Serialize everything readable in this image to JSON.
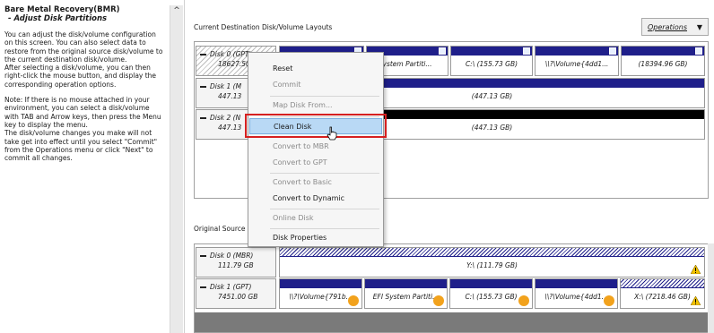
{
  "left_panel": {
    "title": "Bare Metal Recovery(BMR)",
    "subtitle": "- Adjust Disk Partitions",
    "para1": "You can adjust the disk/volume configuration\non this screen. You can also select data to\nrestore from the original source disk/volume to\nthe current destination disk/volume.\nAfter selecting a disk/volume, you can then\nright-click the mouse button, and display the\ncorresponding operation options.",
    "para2": "Note: If there is no mouse attached in your\nenvironment, you can select a disk/volume\nwith TAB and Arrow keys, then press the Menu\nkey to display the menu.\nThe disk/volume changes you make will not\ntake get into effect until you select \"Commit\"\nfrom the Operations menu or click \"Next\" to\ncommit all changes.",
    "scroll_up": "^"
  },
  "destination": {
    "title": "Current Destination Disk/Volume Layouts",
    "operations_label": "Operations",
    "disks": [
      {
        "name": "Disk 0 (GPT)",
        "size": "18627.50 GB",
        "partitions": [
          "ystem Partiti...",
          "C:\\ (155.73 GB)",
          "\\\\?\\Volume{4dd1...",
          "(18394.96 GB)"
        ]
      },
      {
        "name": "Disk 1 (M",
        "size": "447.13",
        "partitions": [
          "(447.13 GB)"
        ]
      },
      {
        "name": "Disk 2 (N",
        "size": "447.13",
        "partitions": [
          "(447.13 GB)"
        ]
      }
    ]
  },
  "context_menu": {
    "items": [
      {
        "label": "Reset",
        "enabled": true
      },
      {
        "label": "Commit",
        "enabled": false
      },
      {
        "label": "Map Disk From...",
        "enabled": false
      },
      {
        "label": "Clean Disk",
        "enabled": true,
        "highlighted": true
      },
      {
        "label": "Convert to MBR",
        "enabled": false
      },
      {
        "label": "Convert to GPT",
        "enabled": false
      },
      {
        "label": "Convert to Basic",
        "enabled": false
      },
      {
        "label": "Convert to Dynamic",
        "enabled": true
      },
      {
        "label": "Online Disk",
        "enabled": false
      },
      {
        "label": "Disk Properties",
        "enabled": true
      }
    ]
  },
  "original": {
    "title": "Original Source",
    "disks": [
      {
        "name": "Disk 0 (MBR)",
        "size": "111.79 GB",
        "partitions": [
          "Y:\\ (111.79 GB)"
        ]
      },
      {
        "name": "Disk 1 (GPT)",
        "size": "7451.00 GB",
        "partitions": [
          "\\\\?\\Volume{791b...",
          "EFI System Partiti...",
          "C:\\ (155.73 GB)",
          "\\\\?\\Volume{4dd1...",
          "X:\\ (7218.46 GB)"
        ]
      }
    ]
  },
  "colors": {
    "partition_bar": "#1f1f8a",
    "highlight_border": "#d62020",
    "menu_selection": "#b9d9f5",
    "warning_icon": "#f2c200",
    "info_icon": "#f2a21c"
  }
}
